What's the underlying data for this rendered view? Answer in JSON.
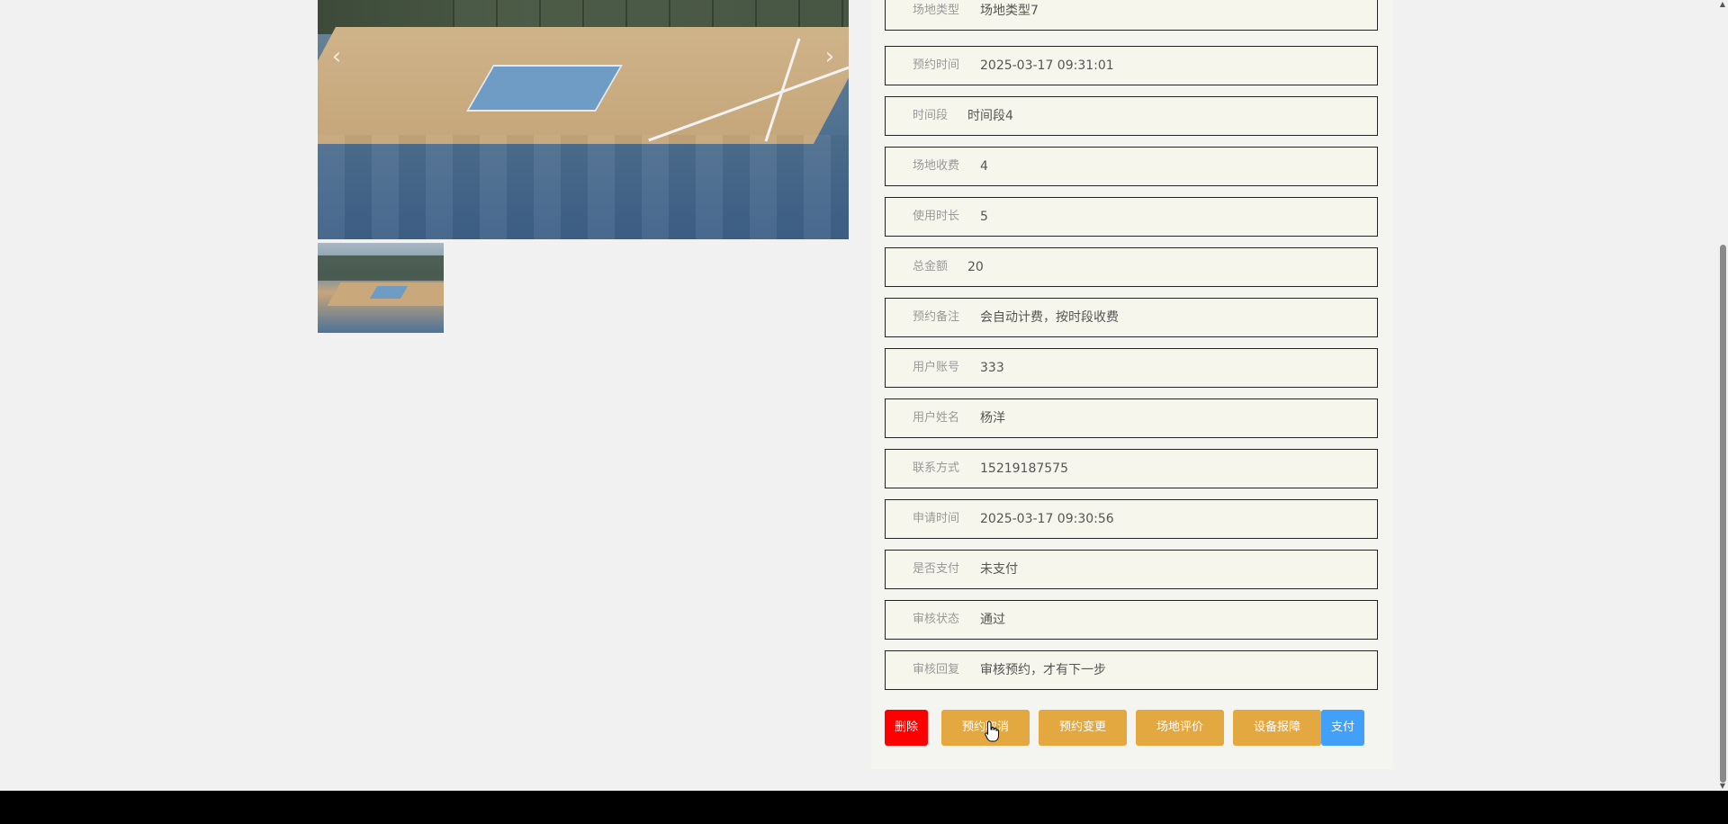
{
  "gallery": {
    "prev_glyph": "‹",
    "next_glyph": "›"
  },
  "details": [
    {
      "label": "场地类型",
      "value": "场地类型7"
    },
    {
      "label": "预约时间",
      "value": "2025-03-17 09:31:01"
    },
    {
      "label": "时间段",
      "value": "时间段4"
    },
    {
      "label": "场地收费",
      "value": "4"
    },
    {
      "label": "使用时长",
      "value": "5"
    },
    {
      "label": "总金额",
      "value": "20"
    },
    {
      "label": "预约备注",
      "value": "会自动计费，按时段收费"
    },
    {
      "label": "用户账号",
      "value": "333"
    },
    {
      "label": "用户姓名",
      "value": "杨洋"
    },
    {
      "label": "联系方式",
      "value": "15219187575"
    },
    {
      "label": "申请时间",
      "value": "2025-03-17 09:30:56"
    },
    {
      "label": "是否支付",
      "value": "未支付"
    },
    {
      "label": "审核状态",
      "value": "通过"
    },
    {
      "label": "审核回复",
      "value": "审核预约，才有下一步"
    }
  ],
  "actions": {
    "delete": "删除",
    "cancel": "预约取消",
    "change": "预约变更",
    "review": "场地评价",
    "report": "设备报障",
    "pay": "支付"
  },
  "colors": {
    "delete": "#ff0000",
    "action": "#e4a841",
    "pay": "#43a0f8",
    "footer": "#000000"
  },
  "scrollbar": {
    "up_glyph": "▲",
    "down_glyph": "▼"
  }
}
